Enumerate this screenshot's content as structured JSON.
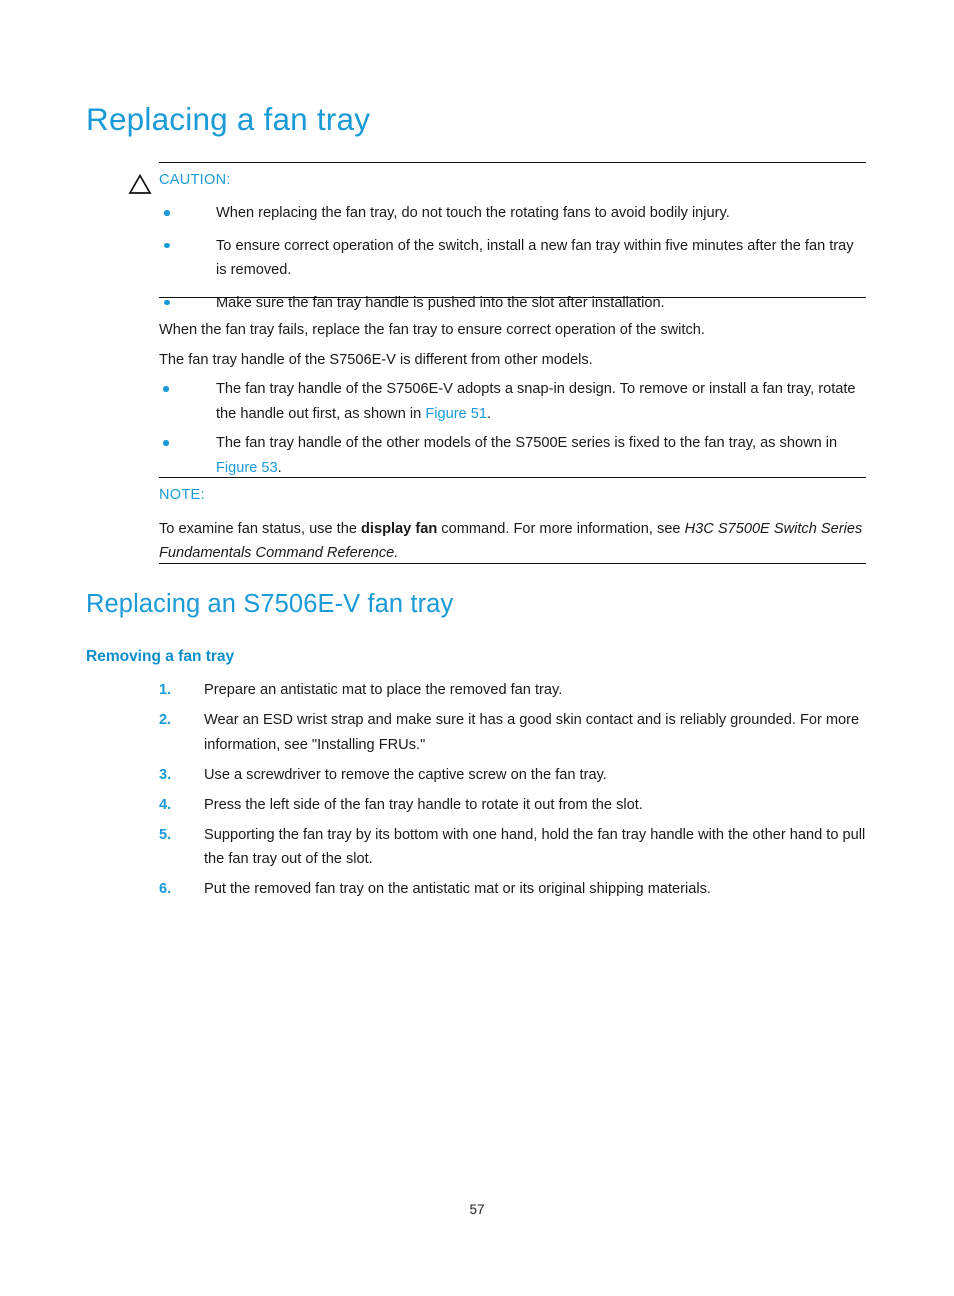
{
  "page": {
    "title": "Replacing a fan tray",
    "folio": "57"
  },
  "caution": {
    "icon": "warning-triangle-icon",
    "label": "CAUTION:",
    "label_color": "#1a9ad7",
    "bullets": [
      "When replacing the fan tray, do not touch the rotating fans to avoid bodily injury.",
      "To ensure correct operation of the switch, install a new fan tray within five minutes after the fan tray is removed.",
      "Make sure the fan tray handle is pushed into the slot after installation."
    ]
  },
  "body": {
    "para1": "When the fan tray fails, replace the fan tray to ensure correct operation of the switch.",
    "para2": "The fan tray handle of the S7506E-V is different from other models.",
    "bullet1_pre": "The fan tray handle of the S7506E-V adopts a snap-in design. To remove or install a fan tray, rotate the handle out first, as shown in ",
    "bullet1_link": "Figure 51",
    "bullet1_post": ".",
    "bullet2_pre": "The fan tray handle of the other models of the S7500E series is fixed to the fan tray, as shown in ",
    "bullet2_link": "Figure 53",
    "bullet2_post": "."
  },
  "note": {
    "label": "NOTE:",
    "text_pre": "To examine fan status, use the ",
    "text_bold": "display fan",
    "text_mid": " command. For more information, see ",
    "text_italic": "H3C S7500E Switch Series Fundamentals Command Reference."
  },
  "section": {
    "heading": "Replacing an S7506E-V fan tray",
    "subheading": "Removing a fan tray",
    "steps": [
      {
        "num": "1.",
        "text": "Prepare an antistatic mat to place the removed fan tray."
      },
      {
        "num": "2.",
        "text": "Wear an ESD wrist strap and make sure it has a good skin contact and is reliably grounded. For more information, see \"Installing FRUs.\""
      },
      {
        "num": "3.",
        "text": "Use a screwdriver to remove the captive screw on the fan tray."
      },
      {
        "num": "4.",
        "text": "Press the left side of the fan tray handle to rotate it out from the slot."
      },
      {
        "num": "5.",
        "text": "Supporting the fan tray by its bottom with one hand, hold the fan tray handle with the other hand to pull the fan tray out of the slot."
      },
      {
        "num": "6.",
        "text": "Put the removed fan tray on the antistatic mat or its original shipping materials."
      }
    ]
  },
  "colors": {
    "heading_blue": "#1a9ad7",
    "rule_black": "#111111",
    "body_text": "#1a1a1a"
  }
}
